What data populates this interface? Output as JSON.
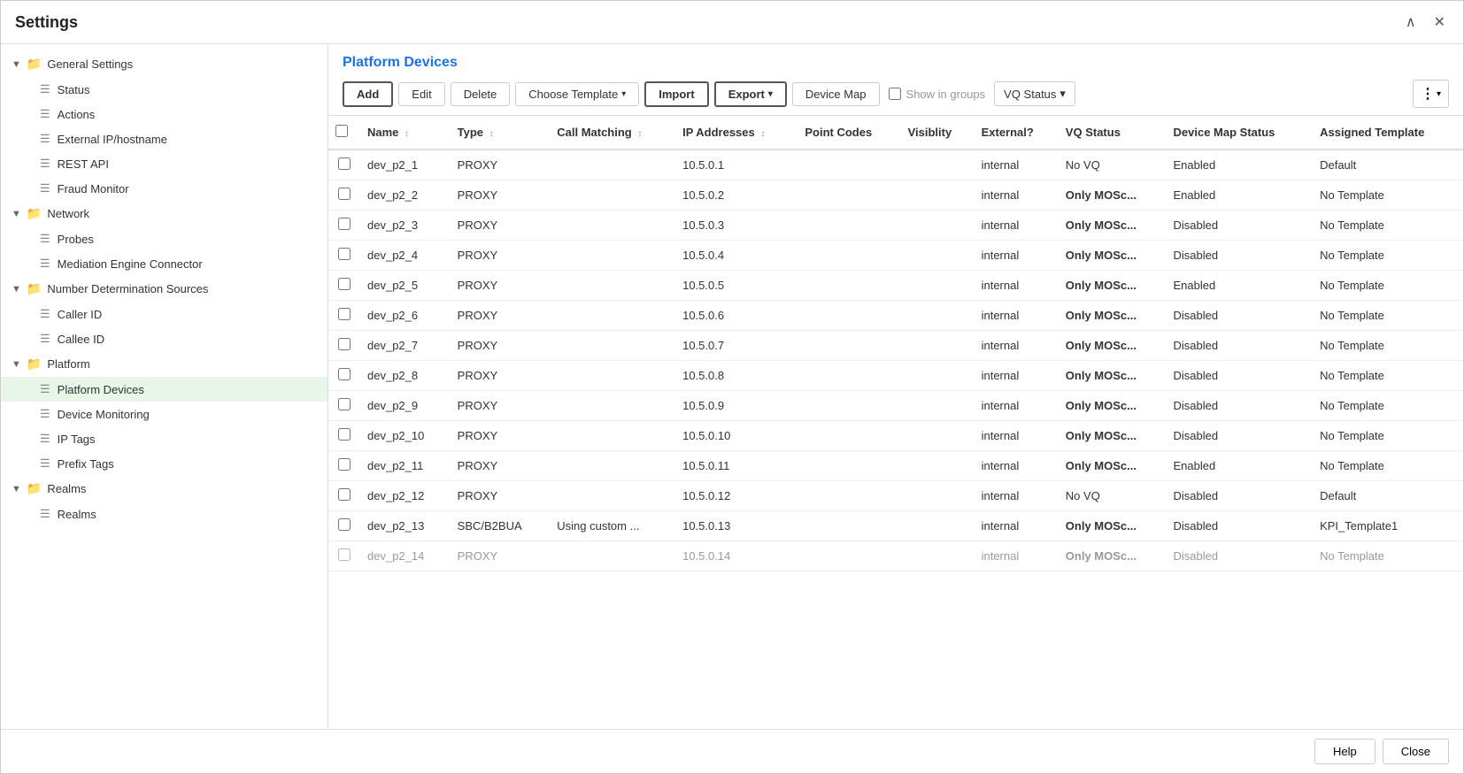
{
  "modal": {
    "title": "Settings",
    "close_label": "✕",
    "minimize_label": "∧"
  },
  "sidebar": {
    "sections": [
      {
        "id": "general-settings",
        "label": "General Settings",
        "expanded": true,
        "children": [
          {
            "id": "status",
            "label": "Status"
          },
          {
            "id": "actions",
            "label": "Actions"
          },
          {
            "id": "external-ip",
            "label": "External IP/hostname"
          },
          {
            "id": "rest-api",
            "label": "REST API"
          },
          {
            "id": "fraud-monitor",
            "label": "Fraud Monitor"
          }
        ]
      },
      {
        "id": "network",
        "label": "Network",
        "expanded": true,
        "children": [
          {
            "id": "probes",
            "label": "Probes"
          },
          {
            "id": "mediation-engine",
            "label": "Mediation Engine Connector"
          }
        ]
      },
      {
        "id": "number-determination",
        "label": "Number Determination Sources",
        "expanded": true,
        "children": [
          {
            "id": "caller-id",
            "label": "Caller ID"
          },
          {
            "id": "callee-id",
            "label": "Callee ID"
          }
        ]
      },
      {
        "id": "platform",
        "label": "Platform",
        "expanded": true,
        "children": [
          {
            "id": "platform-devices",
            "label": "Platform Devices",
            "active": true
          },
          {
            "id": "device-monitoring",
            "label": "Device Monitoring"
          },
          {
            "id": "ip-tags",
            "label": "IP Tags"
          },
          {
            "id": "prefix-tags",
            "label": "Prefix Tags"
          }
        ]
      },
      {
        "id": "realms",
        "label": "Realms",
        "expanded": true,
        "children": [
          {
            "id": "realms-child",
            "label": "Realms"
          }
        ]
      }
    ]
  },
  "content": {
    "title": "Platform Devices",
    "toolbar": {
      "add": "Add",
      "edit": "Edit",
      "delete": "Delete",
      "choose_template": "Choose Template",
      "import": "Import",
      "export": "Export",
      "device_map": "Device Map",
      "show_groups": "Show in groups",
      "vq_status": "VQ Status",
      "more_icon": "⋮"
    },
    "table": {
      "columns": [
        {
          "id": "checkbox",
          "label": ""
        },
        {
          "id": "name",
          "label": "Name",
          "sortable": true
        },
        {
          "id": "type",
          "label": "Type",
          "sortable": true
        },
        {
          "id": "call_matching",
          "label": "Call Matching",
          "sortable": true
        },
        {
          "id": "ip_addresses",
          "label": "IP Addresses",
          "sortable": true
        },
        {
          "id": "point_codes",
          "label": "Point Codes"
        },
        {
          "id": "visibility",
          "label": "Visiblity"
        },
        {
          "id": "external",
          "label": "External?"
        },
        {
          "id": "vq_status",
          "label": "VQ Status"
        },
        {
          "id": "device_map_status",
          "label": "Device Map Status"
        },
        {
          "id": "assigned_template",
          "label": "Assigned Template"
        }
      ],
      "rows": [
        {
          "name": "dev_p2_1",
          "type": "PROXY",
          "call_matching": "",
          "ip_addresses": "10.5.0.1",
          "point_codes": "",
          "visibility": "",
          "external": "internal",
          "vq_status": "No VQ",
          "vq_bold": false,
          "device_map_status": "Enabled",
          "assigned_template": "Default"
        },
        {
          "name": "dev_p2_2",
          "type": "PROXY",
          "call_matching": "",
          "ip_addresses": "10.5.0.2",
          "point_codes": "",
          "visibility": "",
          "external": "internal",
          "vq_status": "Only MOSc...",
          "vq_bold": true,
          "device_map_status": "Enabled",
          "assigned_template": "No Template"
        },
        {
          "name": "dev_p2_3",
          "type": "PROXY",
          "call_matching": "",
          "ip_addresses": "10.5.0.3",
          "point_codes": "",
          "visibility": "",
          "external": "internal",
          "vq_status": "Only MOSc...",
          "vq_bold": true,
          "device_map_status": "Disabled",
          "assigned_template": "No Template"
        },
        {
          "name": "dev_p2_4",
          "type": "PROXY",
          "call_matching": "",
          "ip_addresses": "10.5.0.4",
          "point_codes": "",
          "visibility": "",
          "external": "internal",
          "vq_status": "Only MOSc...",
          "vq_bold": true,
          "device_map_status": "Disabled",
          "assigned_template": "No Template"
        },
        {
          "name": "dev_p2_5",
          "type": "PROXY",
          "call_matching": "",
          "ip_addresses": "10.5.0.5",
          "point_codes": "",
          "visibility": "",
          "external": "internal",
          "vq_status": "Only MOSc...",
          "vq_bold": true,
          "device_map_status": "Enabled",
          "assigned_template": "No Template"
        },
        {
          "name": "dev_p2_6",
          "type": "PROXY",
          "call_matching": "",
          "ip_addresses": "10.5.0.6",
          "point_codes": "",
          "visibility": "",
          "external": "internal",
          "vq_status": "Only MOSc...",
          "vq_bold": true,
          "device_map_status": "Disabled",
          "assigned_template": "No Template"
        },
        {
          "name": "dev_p2_7",
          "type": "PROXY",
          "call_matching": "",
          "ip_addresses": "10.5.0.7",
          "point_codes": "",
          "visibility": "",
          "external": "internal",
          "vq_status": "Only MOSc...",
          "vq_bold": true,
          "device_map_status": "Disabled",
          "assigned_template": "No Template"
        },
        {
          "name": "dev_p2_8",
          "type": "PROXY",
          "call_matching": "",
          "ip_addresses": "10.5.0.8",
          "point_codes": "",
          "visibility": "",
          "external": "internal",
          "vq_status": "Only MOSc...",
          "vq_bold": true,
          "device_map_status": "Disabled",
          "assigned_template": "No Template"
        },
        {
          "name": "dev_p2_9",
          "type": "PROXY",
          "call_matching": "",
          "ip_addresses": "10.5.0.9",
          "point_codes": "",
          "visibility": "",
          "external": "internal",
          "vq_status": "Only MOSc...",
          "vq_bold": true,
          "device_map_status": "Disabled",
          "assigned_template": "No Template"
        },
        {
          "name": "dev_p2_10",
          "type": "PROXY",
          "call_matching": "",
          "ip_addresses": "10.5.0.10",
          "point_codes": "",
          "visibility": "",
          "external": "internal",
          "vq_status": "Only MOSc...",
          "vq_bold": true,
          "device_map_status": "Disabled",
          "assigned_template": "No Template"
        },
        {
          "name": "dev_p2_11",
          "type": "PROXY",
          "call_matching": "",
          "ip_addresses": "10.5.0.11",
          "point_codes": "",
          "visibility": "",
          "external": "internal",
          "vq_status": "Only MOSc...",
          "vq_bold": true,
          "device_map_status": "Enabled",
          "assigned_template": "No Template"
        },
        {
          "name": "dev_p2_12",
          "type": "PROXY",
          "call_matching": "",
          "ip_addresses": "10.5.0.12",
          "point_codes": "",
          "visibility": "",
          "external": "internal",
          "vq_status": "No VQ",
          "vq_bold": false,
          "device_map_status": "Disabled",
          "assigned_template": "Default"
        },
        {
          "name": "dev_p2_13",
          "type": "SBC/B2BUA",
          "call_matching": "Using custom ...",
          "ip_addresses": "10.5.0.13",
          "point_codes": "",
          "visibility": "",
          "external": "internal",
          "vq_status": "Only MOSc...",
          "vq_bold": true,
          "device_map_status": "Disabled",
          "assigned_template": "KPI_Template1"
        },
        {
          "name": "dev_p2_14",
          "type": "PROXY",
          "call_matching": "",
          "ip_addresses": "10.5.0.14",
          "point_codes": "",
          "visibility": "",
          "external": "internal",
          "vq_status": "Only MOSc...",
          "vq_bold": true,
          "device_map_status": "Disabled",
          "assigned_template": "No Template"
        }
      ]
    }
  },
  "footer": {
    "help_label": "Help",
    "close_label": "Close"
  }
}
